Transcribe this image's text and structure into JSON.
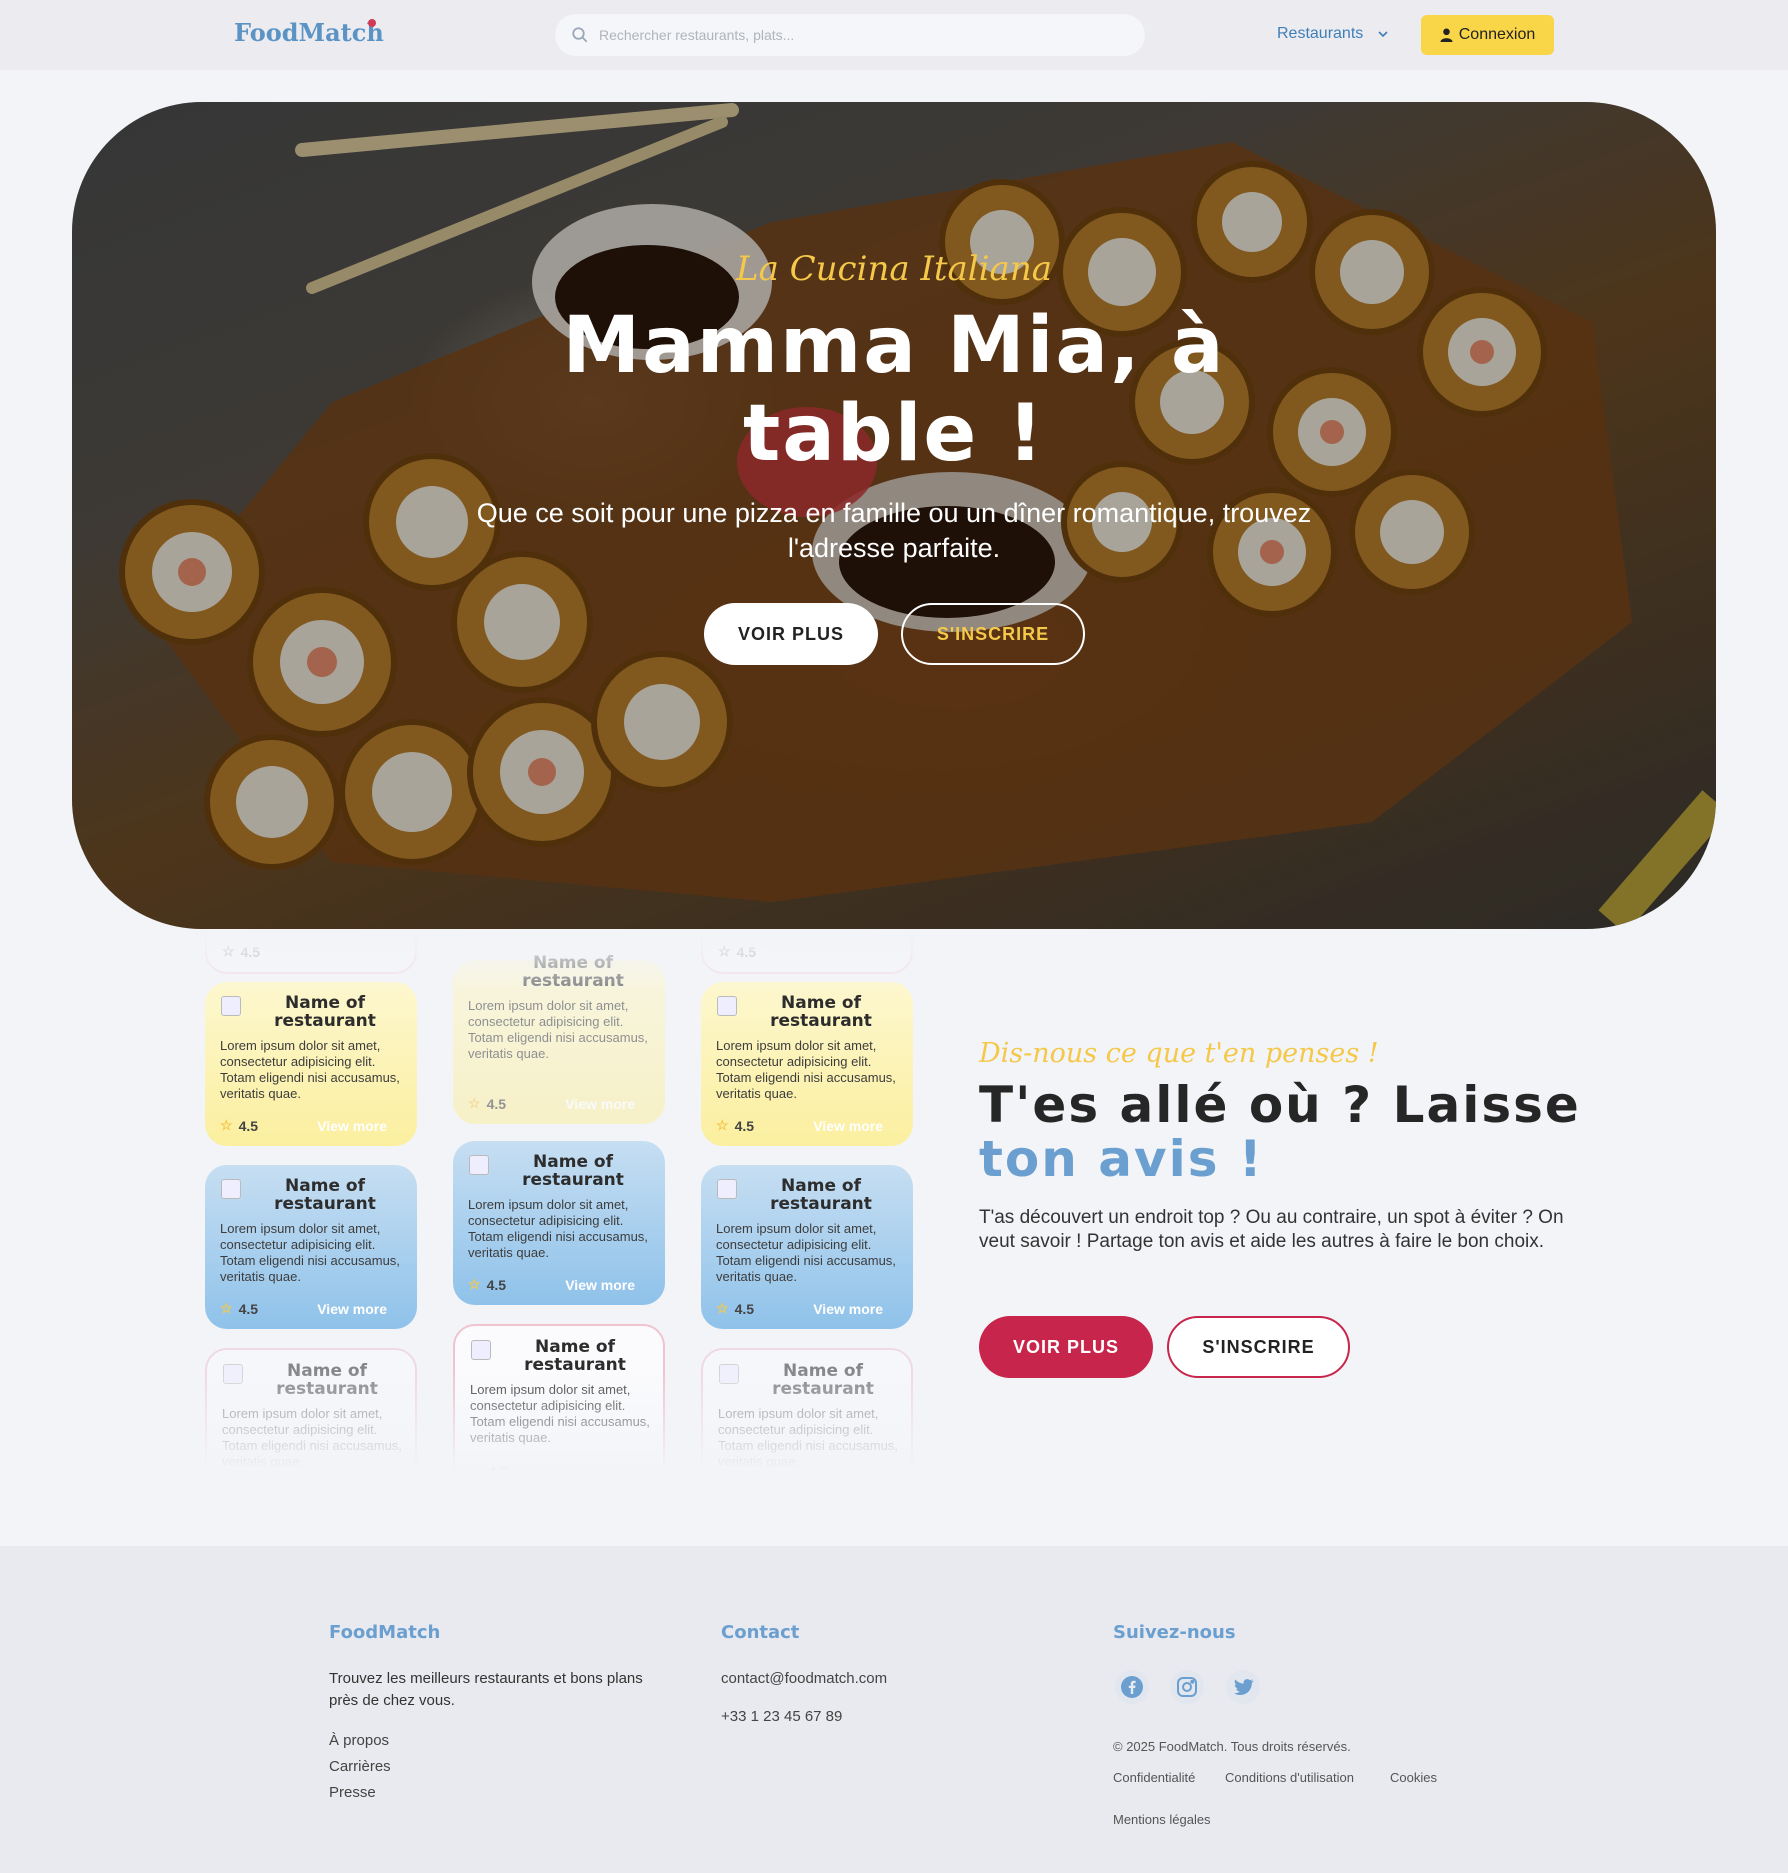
{
  "nav": {
    "logo": "FoodMatch",
    "search_placeholder": "Rechercher restaurants, plats...",
    "dropdown_label": "Restaurants",
    "login_label": "Connexion"
  },
  "hero": {
    "kicker": "La Cucina Italiana",
    "title": "Mamma Mia, à table !",
    "subtitle": "Que ce soit pour une pizza en famille ou un dîner romantique, trouvez l'adresse parfaite.",
    "btn_primary": "VOIR PLUS",
    "btn_secondary": "S'INSCRIRE"
  },
  "cards": {
    "name": "Name of restaurant",
    "description": "Lorem ipsum dolor sit amet, consectetur adipisicing elit. Totam eligendi nisi accusamus, veritatis quae.",
    "rating": "4.5",
    "more": "View more"
  },
  "review": {
    "kicker": "Dis-nous ce que t'en penses !",
    "title_main": "T'es allé où ? Laisse",
    "title_accent": "ton avis !",
    "text": "T'as découvert un endroit top ? Ou au contraire, un spot à éviter ? On veut savoir ! Partage ton avis et aide les autres à faire le bon choix.",
    "btn_primary": "VOIR PLUS",
    "btn_secondary": "S'INSCRIRE"
  },
  "footer": {
    "col1": {
      "title": "FoodMatch",
      "text": "Trouvez les meilleurs restaurants et bons plans près de chez vous.",
      "links": [
        "À propos",
        "Carrières",
        "Presse"
      ]
    },
    "col2": {
      "title": "Contact",
      "email": "contact@foodmatch.com",
      "phone": "+33 1 23 45 67 89"
    },
    "col3": {
      "title": "Suivez-nous",
      "copyright": "© 2025 FoodMatch. Tous droits réservés.",
      "legal_links": [
        "Confidentialité",
        "Conditions d'utilisation",
        "Cookies",
        "Mentions légales"
      ]
    }
  },
  "colors": {
    "brand_blue": "#5b94c4",
    "accent_yellow": "#f9d548",
    "accent_red": "#c8254c"
  },
  "icons": [
    "search-icon",
    "chevron-down-icon",
    "user-icon",
    "star-icon",
    "facebook-icon",
    "instagram-icon",
    "twitter-icon"
  ]
}
